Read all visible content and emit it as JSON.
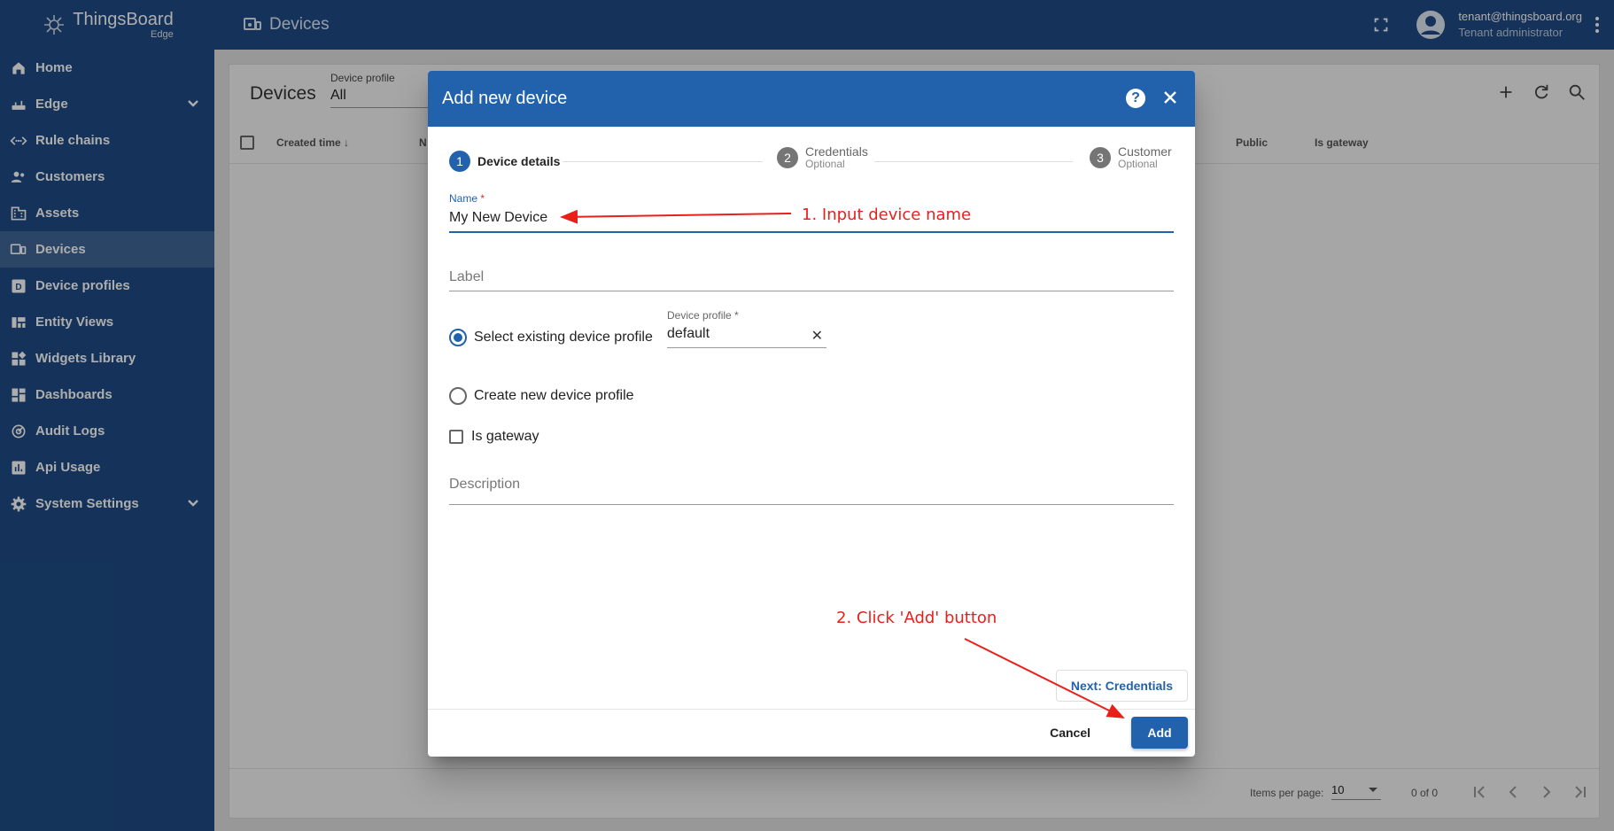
{
  "app": {
    "brand": "ThingsBoard",
    "brand_sub": "Edge"
  },
  "sidebar": {
    "items": [
      {
        "label": "Home",
        "icon": "home-icon"
      },
      {
        "label": "Edge",
        "icon": "router-icon",
        "expandable": true
      },
      {
        "label": "Rule chains",
        "icon": "settings-ethernet-icon"
      },
      {
        "label": "Customers",
        "icon": "supervisor-icon"
      },
      {
        "label": "Assets",
        "icon": "domain-icon"
      },
      {
        "label": "Devices",
        "icon": "devices-other-icon",
        "active": true
      },
      {
        "label": "Device profiles",
        "icon": "device-profile-icon"
      },
      {
        "label": "Entity Views",
        "icon": "view-quilt-icon"
      },
      {
        "label": "Widgets Library",
        "icon": "widgets-icon"
      },
      {
        "label": "Dashboards",
        "icon": "dashboards-icon"
      },
      {
        "label": "Audit Logs",
        "icon": "track-changes-icon"
      },
      {
        "label": "Api Usage",
        "icon": "insert-chart-icon"
      },
      {
        "label": "System Settings",
        "icon": "settings-icon",
        "expandable": true
      }
    ]
  },
  "topbar": {
    "title": "Devices",
    "user_email": "tenant@thingsboard.org",
    "user_role": "Tenant administrator"
  },
  "main": {
    "title": "Devices",
    "filter_label": "Device profile",
    "filter_value": "All",
    "columns": [
      "Created time",
      "N",
      "Public",
      "Is gateway"
    ],
    "footer": {
      "items_per_page_label": "Items per page:",
      "items_per_page_value": "10",
      "range": "0 of 0"
    }
  },
  "dialog": {
    "title": "Add new device",
    "steps": [
      {
        "num": "1",
        "label": "Device details",
        "optional": ""
      },
      {
        "num": "2",
        "label": "Credentials",
        "optional": "Optional"
      },
      {
        "num": "3",
        "label": "Customer",
        "optional": "Optional"
      }
    ],
    "name_label": "Name",
    "name_required": "*",
    "name_value": "My New Device",
    "label_placeholder": "Label",
    "radio_existing": "Select existing device profile",
    "device_profile_label": "Device profile *",
    "device_profile_value": "default",
    "radio_new": "Create new device profile",
    "is_gateway": "Is gateway",
    "description_placeholder": "Description",
    "next_button": "Next: Credentials",
    "cancel_button": "Cancel",
    "add_button": "Add"
  },
  "annotations": {
    "step1": "1. Input device name",
    "step2": "2. Click 'Add' button",
    "color": "#e8201a"
  },
  "colors": {
    "primary": "#2262ad",
    "sidebar": "#1f4c85"
  }
}
